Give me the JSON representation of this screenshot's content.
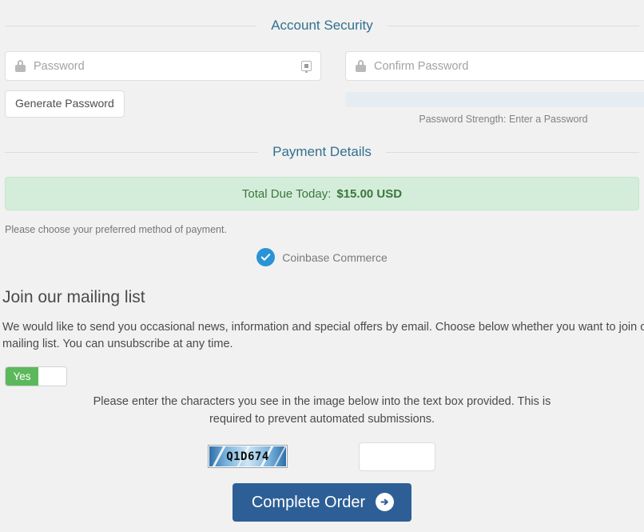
{
  "account_security": {
    "legend": "Account Security",
    "password_placeholder": "Password",
    "confirm_password_placeholder": "Confirm Password",
    "password_value": "",
    "confirm_password_value": "",
    "generate_password_label": "Generate Password",
    "password_strength_label": "Password Strength: Enter a Password",
    "lock_icon": "lock-icon",
    "reveal_icon": "password-reveal-icon"
  },
  "payment_details": {
    "legend": "Payment Details",
    "total_due_label": "Total Due Today:",
    "total_due_amount": "$15.00 USD",
    "choose_method_text": "Please choose your preferred method of payment.",
    "gateways": [
      {
        "label": "Coinbase Commerce",
        "selected": true,
        "icon": "check-circle-icon"
      }
    ]
  },
  "mailing_list": {
    "heading": "Join our mailing list",
    "body": "We would like to send you occasional news, information and special offers by email. Choose below whether you want to join our mailing list. You can unsubscribe at any time.",
    "toggle_on_label": "Yes",
    "toggle_state": "Yes"
  },
  "captcha": {
    "instructions": "Please enter the characters you see in the image below into the text box provided. This is required to prevent automated submissions.",
    "image_text": "Q1D674",
    "input_value": "",
    "input_placeholder": ""
  },
  "submit": {
    "label": "Complete Order",
    "icon": "arrow-right-circle-icon"
  },
  "colors": {
    "page_background": "#f1f1f1",
    "legend_text": "#31708f",
    "legend_rule": "#dcdcdc",
    "total_banner_background": "#d4edda",
    "total_banner_border": "#c3e6cb",
    "total_banner_text": "#3c763d",
    "gateway_radio": "#2a93d5",
    "toggle_on": "#5cb85c",
    "submit_button": "#2d5f96",
    "strength_bar": "#e6edf2",
    "input_border": "#dfdfdf",
    "body_text": "#4a4a4a",
    "muted_text": "#828282"
  }
}
